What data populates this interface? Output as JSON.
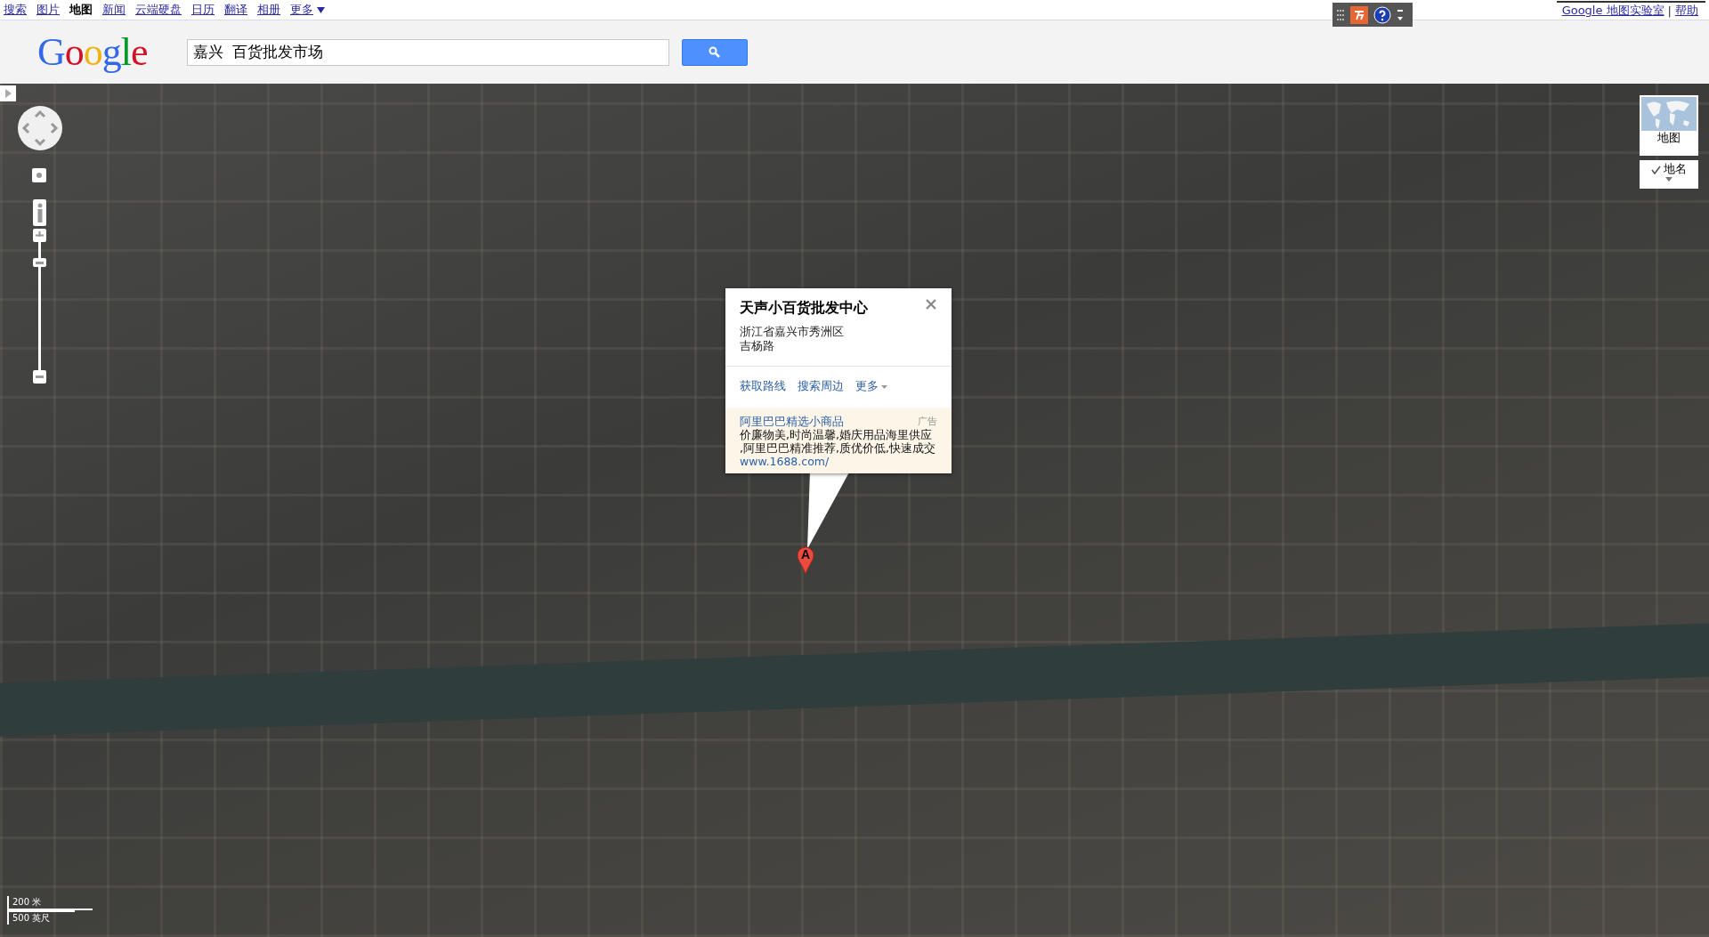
{
  "top_nav": {
    "links": [
      {
        "label": "搜索",
        "selected": false
      },
      {
        "label": "图片",
        "selected": false
      },
      {
        "label": "地图",
        "selected": true
      },
      {
        "label": "新闻",
        "selected": false
      },
      {
        "label": "云端硬盘",
        "selected": false
      },
      {
        "label": "日历",
        "selected": false
      },
      {
        "label": "翻译",
        "selected": false
      },
      {
        "label": "相册",
        "selected": false
      },
      {
        "label": "更多",
        "selected": false
      }
    ],
    "right_links": [
      "Google 地图实验室",
      "帮助"
    ],
    "separator": "|"
  },
  "header": {
    "logo": "Google",
    "search": {
      "value": "嘉兴  百货批发市场"
    }
  },
  "info_window": {
    "title": "天声小百货批发中心",
    "address_lines": [
      "浙江省嘉兴市秀洲区",
      "吉杨路"
    ],
    "actions": [
      "获取路线",
      "搜索周边",
      "更多"
    ],
    "ad": {
      "title": "阿里巴巴精选小商品",
      "label": "广告",
      "lines": [
        "价廉物美,时尚温馨,婚庆用品海里供应",
        ",阿里巴巴精准推荐,质优价低,快速成交"
      ],
      "url": "www.1688.com/"
    }
  },
  "marker": {
    "label": "A"
  },
  "map_type": {
    "map_button": "地图",
    "labels_option": {
      "label": "地名",
      "checked": true
    }
  },
  "scale": [
    "200 米",
    "500 英尺"
  ]
}
